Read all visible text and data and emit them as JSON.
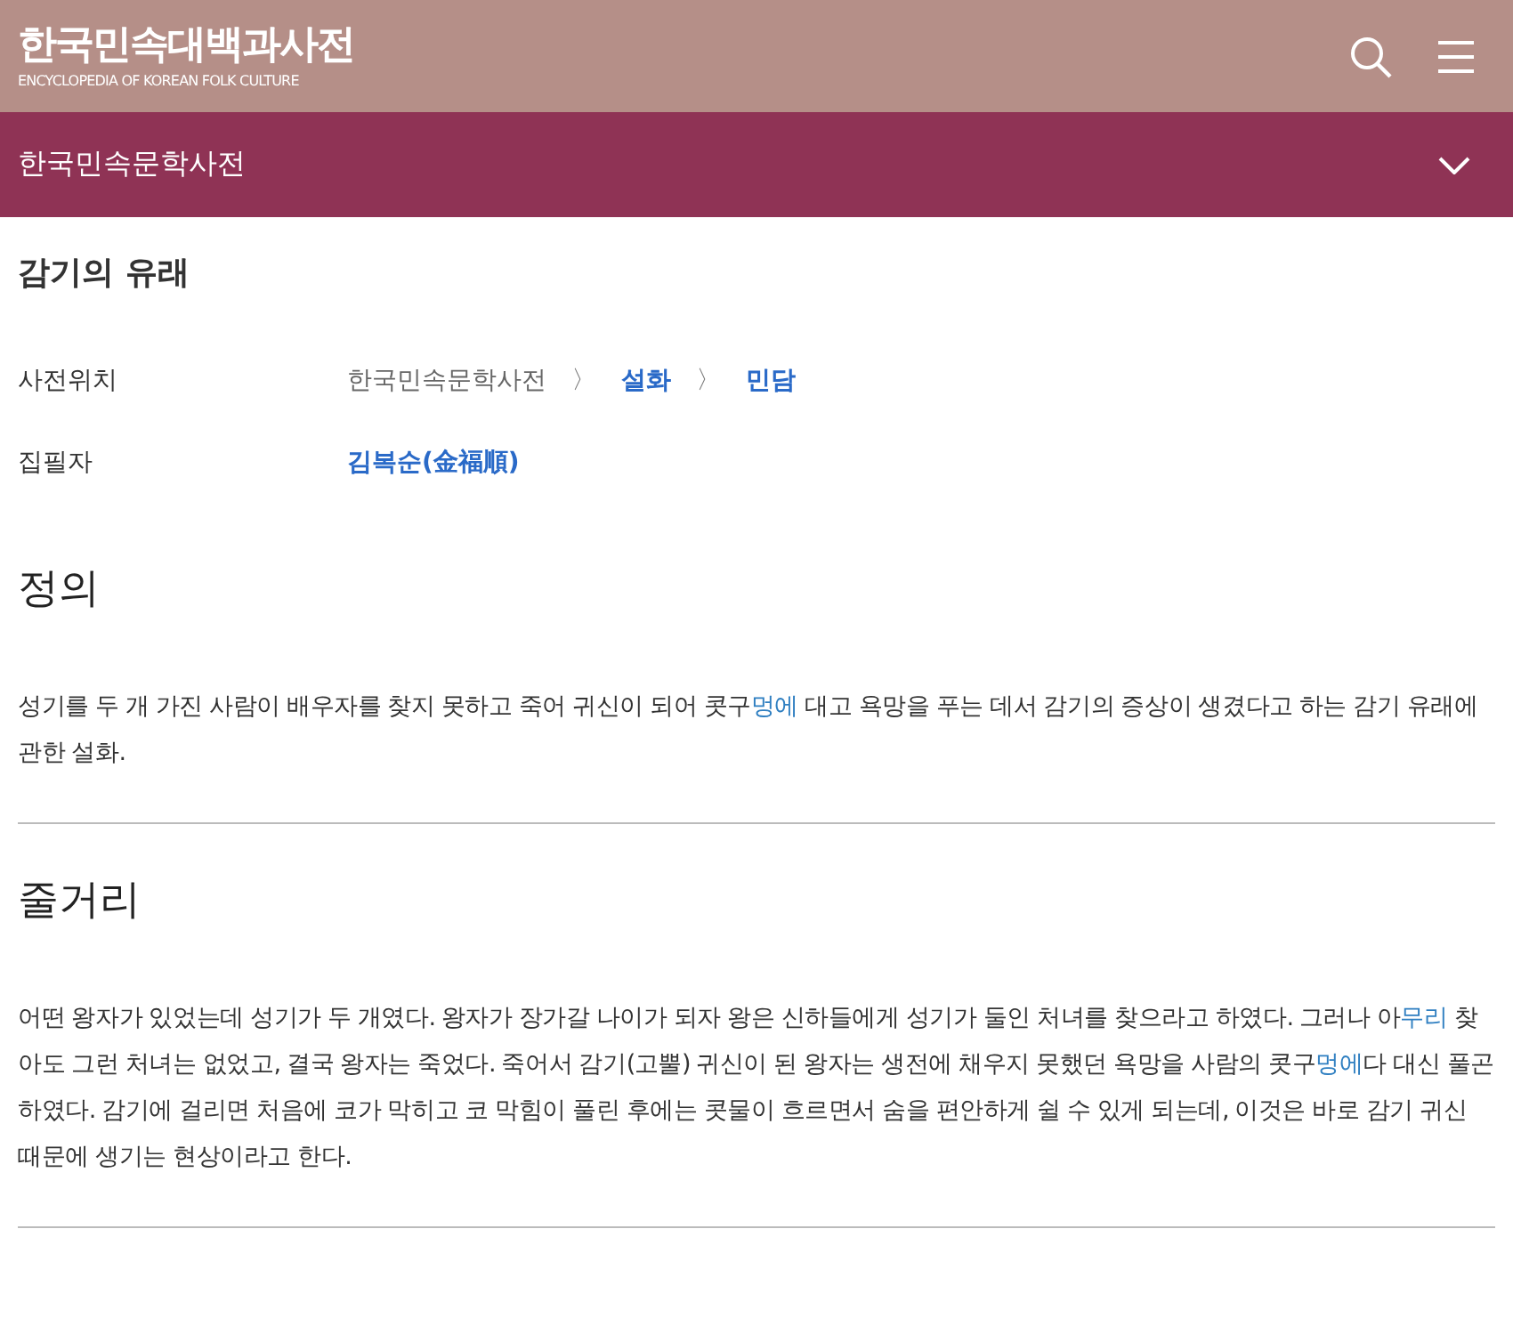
{
  "header": {
    "logo_title": "한국민속대백과사전",
    "logo_subtitle": "ENCYCLOPEDIA OF KOREAN FOLK CULTURE"
  },
  "subheader": {
    "title": "한국민속문학사전",
    "expanded": false
  },
  "article": {
    "title": "감기의 유래",
    "info": [
      {
        "label": "사전위치",
        "separator": "〉",
        "path": [
          {
            "text": "한국민속문학사전",
            "link": false
          },
          {
            "text": "설화",
            "link": true
          },
          {
            "text": "민담",
            "link": true
          }
        ]
      },
      {
        "label": "집필자",
        "path": [
          {
            "text": "김복순(金福順)",
            "link": true
          }
        ]
      }
    ],
    "sections": [
      {
        "heading": "정의",
        "paragraph": [
          {
            "text": "성기를 두 개 가진 사람이 배우자를 찾지 못하고 죽어 귀신이 되어 콧구",
            "link": false
          },
          {
            "text": "멍에",
            "link": true
          },
          {
            "text": " 대고 욕망을 푸는 데서 감기의 증상이 생겼다고 하는 감기 유래에 관한 설화.",
            "link": false
          }
        ]
      },
      {
        "heading": "줄거리",
        "paragraph": [
          {
            "text": "어떤 왕자가 있었는데 성기가 두 개였다. 왕자가 장가갈 나이가 되자 왕은 신하들에게 성기가 둘인 처녀를 찾으라고 하였다. 그러나 아",
            "link": false
          },
          {
            "text": "무리",
            "link": true
          },
          {
            "text": " 찾아도 그런 처녀는 없었고, 결국 왕자는 죽었다. 죽어서 감기(고뿔) 귀신이 된 왕자는 생전에 채우지 못했던 욕망을 사람의 콧구",
            "link": false
          },
          {
            "text": "멍에",
            "link": true
          },
          {
            "text": "다 대신 풀곤 하였다. 감기에 걸리면 처음에 코가 막히고 코 막힘이 풀린 후에는 콧물이 흐르면서 숨을 편안하게 쉴 수 있게 되는데, 이것은 바로 감기 귀신 때문에 생기는 현상이라고 한다.",
            "link": false
          }
        ]
      }
    ]
  }
}
